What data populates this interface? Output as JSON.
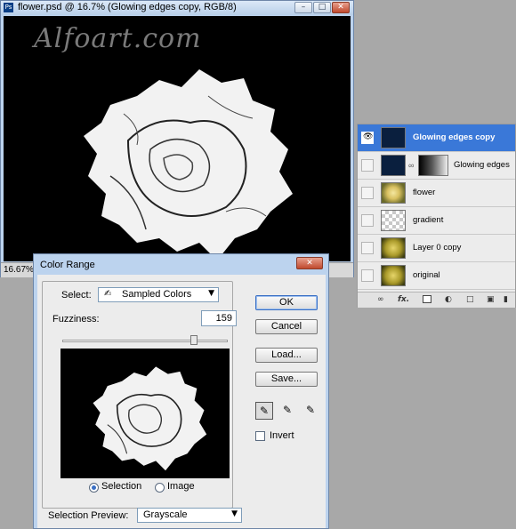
{
  "document_window": {
    "title": "flower.psd @ 16.7% (Glowing edges copy, RGB/8)",
    "app_icon": "Ps",
    "watermark": "Alfoart.com",
    "zoom": "16.67%",
    "minimize_icon": "minimize-icon",
    "maximize_icon": "maximize-icon",
    "close_icon": "close-icon"
  },
  "layers_panel": {
    "layers": [
      {
        "name": "Glowing edges copy",
        "visible": true,
        "selected": true,
        "thumbnail": "dark-flower"
      },
      {
        "name": "Glowing edges",
        "visible": false,
        "selected": false,
        "thumbnail": "dark-flower",
        "has_mask": true
      },
      {
        "name": "flower",
        "visible": false,
        "selected": false,
        "thumbnail": "yellow-flower"
      },
      {
        "name": "gradient",
        "visible": false,
        "selected": false,
        "thumbnail": "transparent"
      },
      {
        "name": "Layer 0 copy",
        "visible": false,
        "selected": false,
        "thumbnail": "dark-yellow-flower"
      },
      {
        "name": "original",
        "visible": false,
        "selected": false,
        "thumbnail": "dark-yellow-flower"
      }
    ],
    "footer_icons": [
      "link-layers-icon",
      "fx-icon",
      "add-mask-icon",
      "adjustment-layer-icon",
      "new-group-icon",
      "new-layer-icon",
      "delete-layer-icon"
    ],
    "fx_label": "fx."
  },
  "color_range_dialog": {
    "title": "Color Range",
    "select_label": "Select:",
    "select_value": "Sampled Colors",
    "fuzziness_label": "Fuzziness:",
    "fuzziness_value": "159",
    "fuzziness_slider_level": 0.79,
    "radio_selection": "Selection",
    "radio_image": "Image",
    "radio_checked": "Selection",
    "selection_preview_label": "Selection Preview:",
    "selection_preview_value": "Grayscale",
    "buttons": {
      "ok": "OK",
      "cancel": "Cancel",
      "load": "Load...",
      "save": "Save..."
    },
    "invert_label": "Invert",
    "invert_checked": false,
    "eyedroppers": [
      "eyedropper-icon",
      "eyedropper-plus-icon",
      "eyedropper-minus-icon"
    ]
  },
  "colors": {
    "title_bar": "#bcd3ee",
    "selected_layer": "#3a78d8",
    "close_button": "#c0492e"
  }
}
